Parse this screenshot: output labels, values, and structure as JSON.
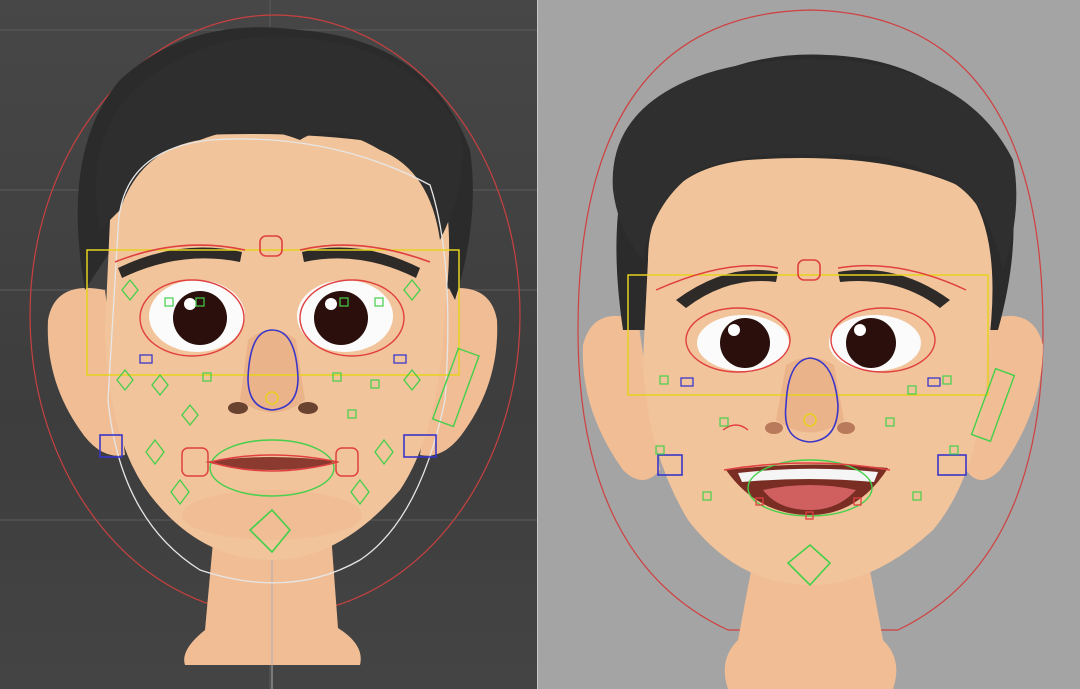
{
  "viewports": [
    {
      "name": "left-viewport",
      "background": "#444444",
      "grid_color": "#5a5a5a"
    },
    {
      "name": "right-viewport",
      "background": "#a4a4a4"
    }
  ],
  "colors": {
    "skin": "#f2c49b",
    "skin_shadow": "#d99a73",
    "hair": "#2b2b2b",
    "eye": "#2a0f0c",
    "brow": "#2e2a28",
    "control_red": "#e04040",
    "control_yellow": "#e6d21e",
    "control_green": "#44d04a",
    "control_blue": "#3a36c8",
    "control_white": "#e6e6e6"
  }
}
